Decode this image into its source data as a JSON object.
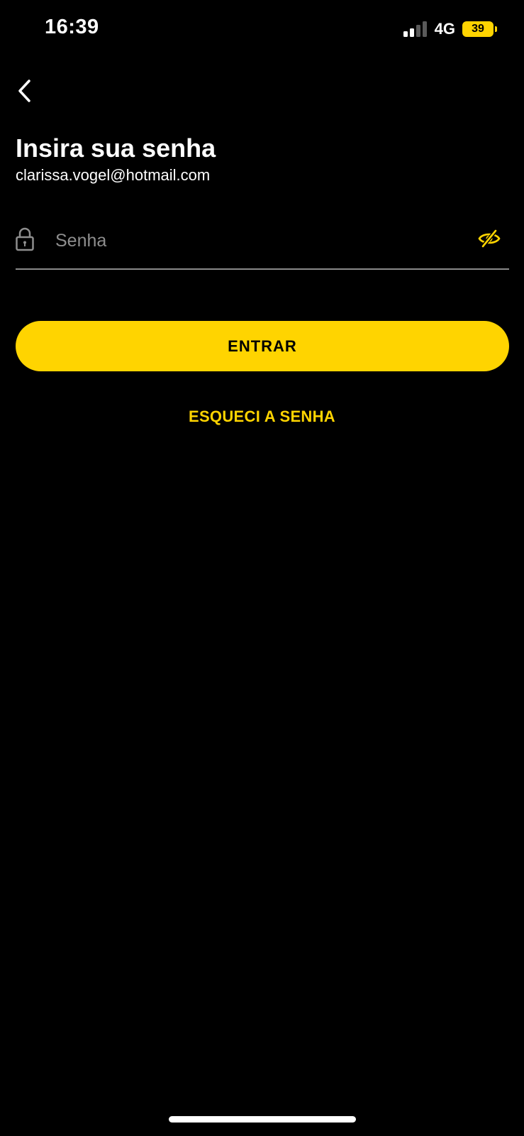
{
  "status_bar": {
    "time": "16:39",
    "network": "4G",
    "battery": "39",
    "signal_bars_active": 2,
    "signal_bars_total": 4
  },
  "header": {
    "back_icon": "chevron-left-icon",
    "title": "Insira sua senha",
    "email": "clarissa.vogel@hotmail.com"
  },
  "password_field": {
    "lock_icon": "lock-icon",
    "placeholder": "Senha",
    "value": "",
    "visibility_icon": "eye-slash-icon"
  },
  "actions": {
    "enter_label": "ENTRAR",
    "forgot_label": "ESQUECI A SENHA"
  },
  "colors": {
    "background": "#000000",
    "accent": "#ffd400",
    "text": "#ffffff",
    "placeholder": "#8e8e8e",
    "divider": "#8a8a8a"
  }
}
